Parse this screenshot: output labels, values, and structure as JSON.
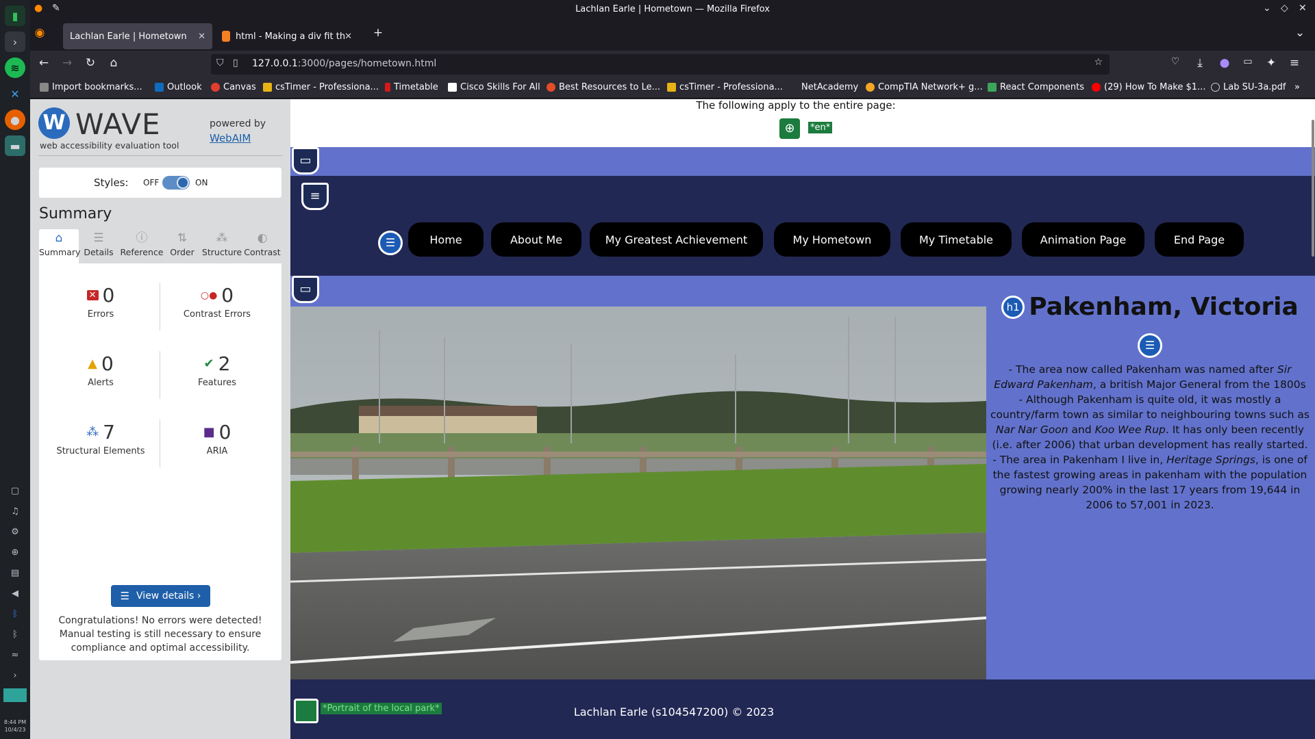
{
  "window": {
    "title": "Lachlan Earle | Hometown — Mozilla Firefox"
  },
  "tabs": [
    {
      "label": "Lachlan Earle | Hometown",
      "active": true
    },
    {
      "label": "html - Making a div fit the",
      "active": false
    }
  ],
  "url": {
    "host": "127.0.0.1",
    "rest": ":3000/pages/hometown.html"
  },
  "bookmarks": [
    "Import bookmarks...",
    "Outlook",
    "Canvas",
    "csTimer - Professiona...",
    "Timetable",
    "Cisco Skills For All",
    "Best Resources to Le...",
    "csTimer - Professiona...",
    "NetAcademy",
    "CompTIA Network+ g...",
    "React Components",
    "(29) How To Make $1...",
    "Lab SU-3a.pdf"
  ],
  "os": {
    "time": "8:44 PM",
    "date": "10/4/23"
  },
  "wave": {
    "logo": "W",
    "name": "WAVE",
    "tagline": "web accessibility evaluation tool",
    "powered_by": "powered by",
    "webaim": "WebAIM",
    "styles_label": "Styles:",
    "styles_off": "OFF",
    "styles_on": "ON",
    "summary_title": "Summary",
    "tabs": [
      "Summary",
      "Details",
      "Reference",
      "Order",
      "Structure",
      "Contrast"
    ],
    "stats": {
      "errors": {
        "value": "0",
        "label": "Errors"
      },
      "contrast": {
        "value": "0",
        "label": "Contrast Errors"
      },
      "alerts": {
        "value": "0",
        "label": "Alerts"
      },
      "features": {
        "value": "2",
        "label": "Features"
      },
      "structural": {
        "value": "7",
        "label": "Structural Elements"
      },
      "aria": {
        "value": "0",
        "label": "ARIA"
      }
    },
    "view_details": "View details ›",
    "congrats": "Congratulations! No errors were detected! Manual testing is still necessary to ensure compliance and optimal accessibility."
  },
  "page": {
    "lang_text": "The following apply to the entire page:",
    "lang_tag": "*en*",
    "nav": [
      "Home",
      "About Me",
      "My Greatest Achievement",
      "My Hometown",
      "My Timetable",
      "Animation Page",
      "End Page"
    ],
    "h1_badge": "h1",
    "heading": "Pakenham, Victoria",
    "paragraphs": {
      "p1a": "- The area now called Pakenham was named after ",
      "p1b": "Sir Edward Pakenham",
      "p1c": ", a british Major General from the 1800s",
      "p2a": "- Although Pakenham is quite old, it was mostly a country/farm town as similar to neighbouring towns such as ",
      "p2b": "Nar Nar Goon",
      "p2c": " and ",
      "p2d": "Koo Wee Rup",
      "p2e": ". It has only been recently (i.e. after 2006) that urban development has really started.",
      "p3a": "- The area in Pakenham I live in, ",
      "p3b": "Heritage Springs",
      "p3c": ", is one of the fastest growing areas in pakenham with the population growing nearly 200% in the last 17 years from 19,644 in 2006 to 57,001 in 2023."
    },
    "image_alt": "*Portrait of the local park*",
    "footer": "Lachlan Earle (s104547200) © 2023"
  }
}
